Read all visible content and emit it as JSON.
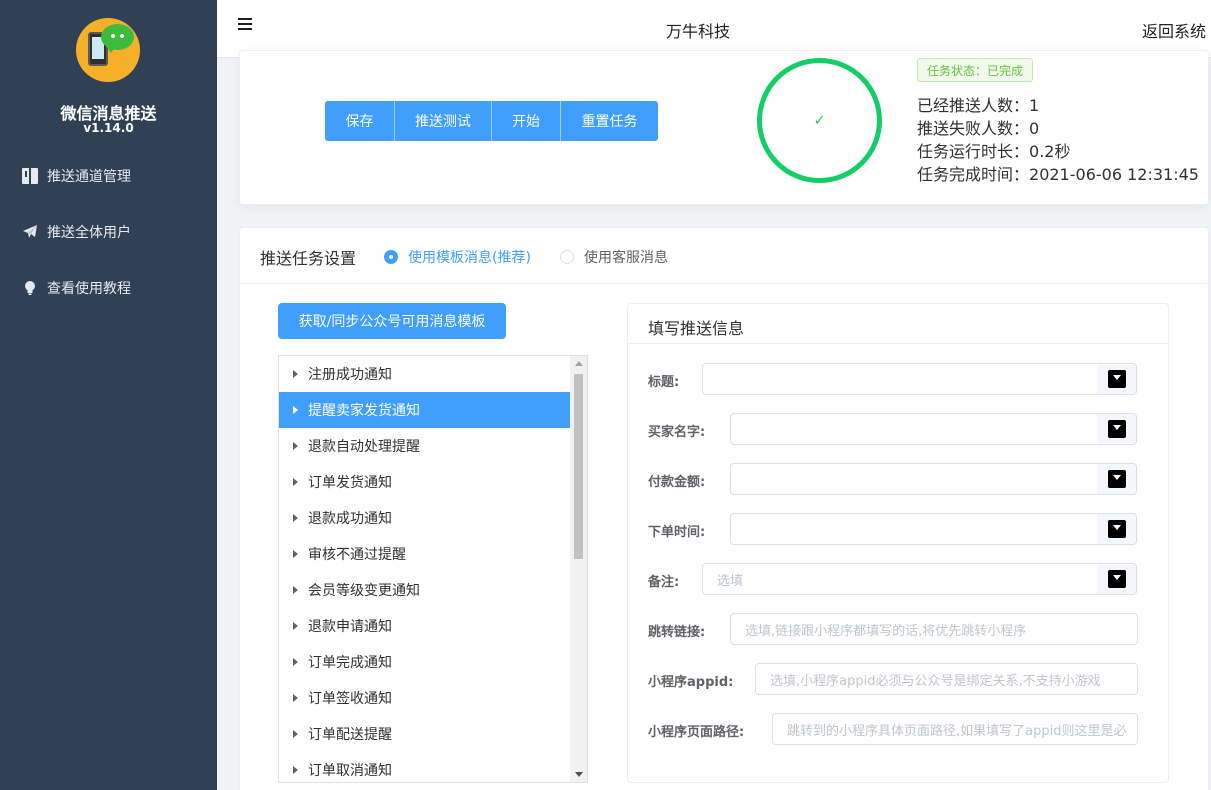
{
  "sidebar": {
    "app_name": "微信消息推送",
    "version": "v1.14.0",
    "items": [
      {
        "label": "推送通道管理",
        "icon": "book-icon"
      },
      {
        "label": "推送全体用户",
        "icon": "paper-plane-icon"
      },
      {
        "label": "查看使用教程",
        "icon": "lightbulb-icon"
      }
    ]
  },
  "header": {
    "title": "万牛科技",
    "back_label": "返回系统"
  },
  "task": {
    "buttons": [
      "保存",
      "推送测试",
      "开始",
      "重置任务"
    ],
    "progress_percent": 100,
    "progress_icon": "check-icon",
    "status_tag": "任务状态：已完成",
    "stats": [
      {
        "label": "已经推送人数：",
        "value": "1"
      },
      {
        "label": "推送失败人数：",
        "value": "0"
      },
      {
        "label": "任务运行时长：",
        "value": "0.2秒"
      },
      {
        "label": "任务完成时间：",
        "value": "2021-06-06 12:31:45"
      }
    ]
  },
  "settings": {
    "title": "推送任务设置",
    "radio_template": "使用模板消息(推荐)",
    "radio_service": "使用客服消息",
    "selected_mode": "template",
    "sync_button": "获取/同步公众号可用消息模板",
    "templates": [
      "注册成功通知",
      "提醒卖家发货通知",
      "退款自动处理提醒",
      "订单发货通知",
      "退款成功通知",
      "审核不通过提醒",
      "会员等级变更通知",
      "退款申请通知",
      "订单完成通知",
      "订单签收通知",
      "订单配送提醒",
      "订单取消通知"
    ],
    "selected_template": "提醒卖家发货通知"
  },
  "form": {
    "title": "填写推送信息",
    "fields": [
      {
        "label": "标题:",
        "value": "",
        "placeholder": "",
        "color_picker": true
      },
      {
        "label": "买家名字:",
        "value": "",
        "placeholder": "",
        "color_picker": true
      },
      {
        "label": "付款金额:",
        "value": "",
        "placeholder": "",
        "color_picker": true
      },
      {
        "label": "下单时间:",
        "value": "",
        "placeholder": "",
        "color_picker": true
      },
      {
        "label": "备注:",
        "value": "",
        "placeholder": "选填",
        "color_picker": true
      },
      {
        "label": "跳转链接:",
        "value": "",
        "placeholder": "选填,链接跟小程序都填写的话,将优先跳转小程序",
        "color_picker": false
      },
      {
        "label": "小程序appid:",
        "value": "",
        "placeholder": "选填,小程序appid必须与公众号是绑定关系,不支持小游戏",
        "color_picker": false
      },
      {
        "label": "小程序页面路径:",
        "value": "",
        "placeholder": "跳转到的小程序具体页面路径,如果填写了appid则这里是必",
        "color_picker": false
      }
    ]
  },
  "colors": {
    "sidebar_bg": "#304156",
    "primary": "#409eff",
    "success": "#13ce66",
    "picker_color": "#000000"
  }
}
